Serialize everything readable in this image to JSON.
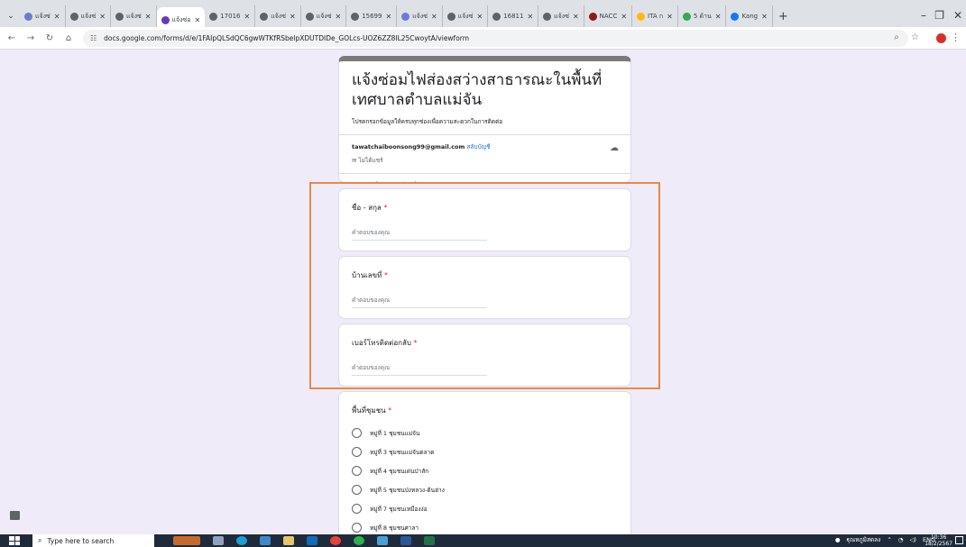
{
  "browser": {
    "tabs": [
      {
        "label": "แจ้งซ่",
        "favicon_color": "#6a7bd8"
      },
      {
        "label": "แจ้งซ่",
        "favicon_color": "#5f6368"
      },
      {
        "label": "แจ้งซ่",
        "favicon_color": "#5f6368"
      },
      {
        "label": "แจ้งซ่อ",
        "favicon_color": "#673ab7",
        "active": true
      },
      {
        "label": "17016",
        "favicon_color": "#5f6368"
      },
      {
        "label": "แจ้งซ่",
        "favicon_color": "#5f6368"
      },
      {
        "label": "แจ้งซ่",
        "favicon_color": "#5f6368"
      },
      {
        "label": "15699",
        "favicon_color": "#5f6368"
      },
      {
        "label": "แจ้งซ่",
        "favicon_color": "#6a7bd8"
      },
      {
        "label": "แจ้งซ่",
        "favicon_color": "#5f6368"
      },
      {
        "label": "16811",
        "favicon_color": "#5f6368"
      },
      {
        "label": "แจ้งซ่",
        "favicon_color": "#5f6368"
      },
      {
        "label": "NACC",
        "favicon_color": "#8b1a1a"
      },
      {
        "label": "ITA ก",
        "favicon_color": "#fbbc04"
      },
      {
        "label": "5 ด้าน",
        "favicon_color": "#34a853"
      },
      {
        "label": "Kang",
        "favicon_color": "#1877f2"
      }
    ],
    "url": "docs.google.com/forms/d/e/1FAIpQLSdQC6gwWTKfRSbelpXDUTDIDe_GOLcs-UOZ6ZZ8IL25CwoytA/viewform"
  },
  "form": {
    "title": "แจ้งซ่อมไฟส่องสว่างสาธารณะในพื้นที่เทศบาลตำบลแม่จัน",
    "description": "โปรดกรอกข้อมูลให้ครบทุกช่องเพื่อความสะดวกในการติดต่อ",
    "account_email": "tawatchaiboonsong99@gmail.com",
    "switch_account": "สลับบัญชี",
    "not_shared": "ไม่ได้แชร์",
    "required_note": "* ระบุว่าเป็นคำถามที่จำเป็น",
    "answer_placeholder": "คำตอบของคุณ",
    "questions": [
      {
        "label": "ชื่อ - สกุล",
        "required_mark": "*"
      },
      {
        "label": "บ้านเลขที่",
        "required_mark": "*"
      },
      {
        "label": "เบอร์โทรติดต่อกลับ",
        "required_mark": "*"
      }
    ],
    "radio_question": {
      "label": "พื้นที่ชุมชน",
      "required_mark": "*",
      "options": [
        "หมู่ที่ 1 ชุมชนแม่จัน",
        "หมู่ที่ 3 ชุมชนแม่จันตลาด",
        "หมู่ที่ 4 ชุมชนเด่นป่าสัก",
        "หมู่ที่ 5 ชุมชนป่งหลวง-ต้นฮ่าง",
        "หมู่ที่ 7 ชุมชนเหมืองง่อ",
        "หมู่ที่ 8 ชุมชนศาลา"
      ]
    }
  },
  "taskbar": {
    "search_placeholder": "Type here to search",
    "tray_user": "ฐุณหภูมิสดลง",
    "language": "ENG",
    "time": "10:36",
    "date": "18/2/2567"
  }
}
